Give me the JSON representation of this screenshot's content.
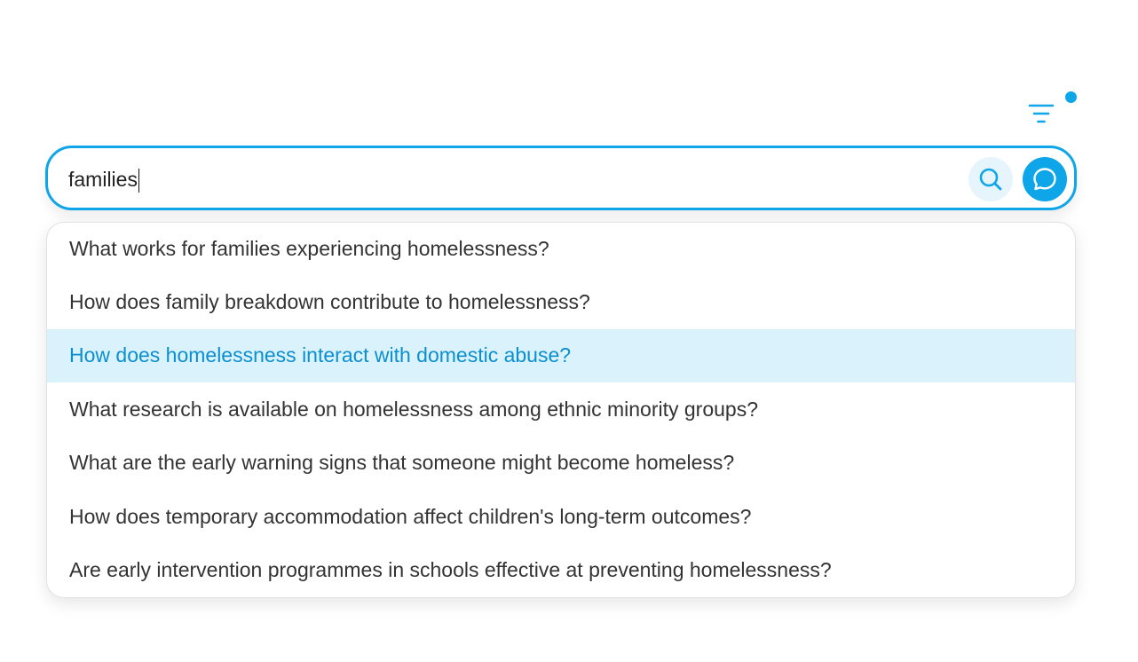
{
  "colors": {
    "accent": "#0ea5e9",
    "highlight_bg": "#daf2fc",
    "highlight_text": "#0b8fd0",
    "text": "#333333",
    "search_btn_bg": "#e6f5fc"
  },
  "filter": {
    "icon": "filter-lines-icon",
    "active_indicator": true
  },
  "search": {
    "value": "families",
    "search_icon": "search-icon",
    "chat_icon": "chat-bubble-icon"
  },
  "suggestions": [
    {
      "text": "What works for families experiencing homelessness?",
      "highlighted": false
    },
    {
      "text": "How does family breakdown contribute to homelessness?",
      "highlighted": false
    },
    {
      "text": "How does homelessness interact with domestic abuse?",
      "highlighted": true
    },
    {
      "text": "What research is available on homelessness among ethnic minority groups?",
      "highlighted": false
    },
    {
      "text": "What are the early warning signs that someone might become homeless?",
      "highlighted": false
    },
    {
      "text": "How does temporary accommodation affect children's long-term outcomes?",
      "highlighted": false
    },
    {
      "text": "Are early intervention programmes in schools effective at preventing homelessness?",
      "highlighted": false
    }
  ]
}
